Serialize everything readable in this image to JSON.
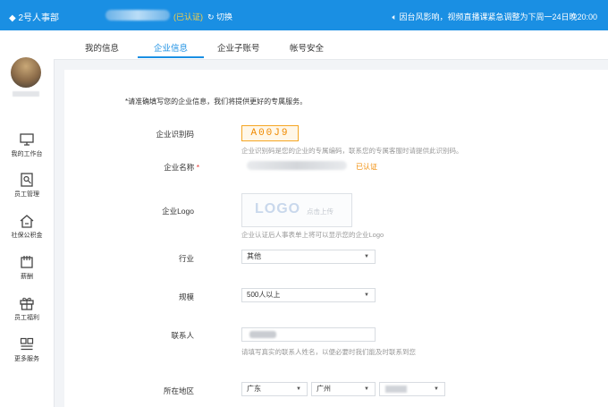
{
  "header": {
    "app_name": "2号人事部",
    "verified_tag": "(已认证)",
    "switch_label": "切换",
    "notice": "因台风影响，视频直播课紧急调整为下周一24日晚20:00"
  },
  "sidebar": {
    "items": [
      {
        "label": "我的工作台",
        "icon": "monitor-icon"
      },
      {
        "label": "员工管理",
        "icon": "employee-search-icon"
      },
      {
        "label": "社保公积金",
        "icon": "house-icon"
      },
      {
        "label": "薪酬",
        "icon": "wallet-icon"
      },
      {
        "label": "员工福利",
        "icon": "gift-icon"
      },
      {
        "label": "更多服务",
        "icon": "grid-icon"
      }
    ]
  },
  "tabs": [
    {
      "label": "我的信息",
      "active": false
    },
    {
      "label": "企业信息",
      "active": true
    },
    {
      "label": "企业子账号",
      "active": false
    },
    {
      "label": "帐号安全",
      "active": false
    }
  ],
  "form": {
    "intro": "*请准确填写您的企业信息，我们将提供更好的专属服务。",
    "code_label": "企业识别码",
    "code_value": "A00J9",
    "code_hint": "企业识别码是您的企业的专属编码，联系您的专属客服时请提供此识别码。",
    "name_label": "企业名称",
    "required_mark": "*",
    "verified_badge": "已认证",
    "logo_label": "企业Logo",
    "logo_placeholder": "LOGO",
    "logo_upload_text": "点击上传",
    "logo_hint": "企业认证后人事表单上将可以显示您的企业Logo",
    "industry_label": "行业",
    "industry_value": "其他",
    "scale_label": "规模",
    "scale_value": "500人以上",
    "contact_label": "联系人",
    "contact_hint": "请填写真实的联系人姓名，以便必要时我们能及时联系到您",
    "region_label": "所在地区",
    "province_value": "广东",
    "city_value": "广州"
  },
  "colors": {
    "brand_blue": "#1a8fe3",
    "accent_orange": "#f08a00"
  }
}
